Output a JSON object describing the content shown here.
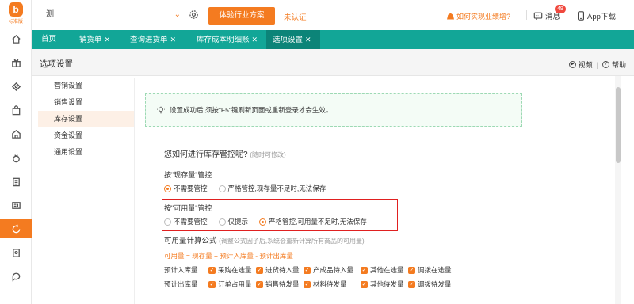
{
  "app": {
    "logo_text": "标准版",
    "logo_mark": "b"
  },
  "topbar": {
    "store_name": "测",
    "trial_button": "体验行业方案",
    "unverified": "未认证",
    "growth_link": "如何实现业绩增?",
    "messages_label": "消息",
    "messages_count": "49",
    "app_download": "App下载"
  },
  "tabs": [
    {
      "label": "首页",
      "closable": false,
      "active": false
    },
    {
      "label": "销货单",
      "closable": true,
      "active": false
    },
    {
      "label": "查询进货单",
      "closable": true,
      "active": false
    },
    {
      "label": "库存成本明细账",
      "closable": true,
      "active": false
    },
    {
      "label": "选项设置",
      "closable": true,
      "active": true
    }
  ],
  "page": {
    "title": "选项设置",
    "video": "视频",
    "help": "帮助"
  },
  "submenu": [
    {
      "label": "营销设置",
      "active": false
    },
    {
      "label": "销售设置",
      "active": false
    },
    {
      "label": "库存设置",
      "active": true
    },
    {
      "label": "资金设置",
      "active": false
    },
    {
      "label": "通用设置",
      "active": false
    }
  ],
  "notice": "设置成功后,须按\"F5\"键刷新页面或重新登录才会生效。",
  "question": {
    "text": "您如何进行库存管控呢?",
    "sub": "(随时可修改)"
  },
  "stock_control": {
    "title": "按\"现存量\"管控",
    "options": [
      {
        "label": "不需要管控",
        "checked": true
      },
      {
        "label": "严格管控,现存量不足时,无法保存",
        "checked": false
      }
    ]
  },
  "available_control": {
    "title": "按\"可用量\"管控",
    "options": [
      {
        "label": "不需要管控",
        "checked": false
      },
      {
        "label": "仅提示",
        "checked": false
      },
      {
        "label": "严格管控,可用量不足时,无法保存",
        "checked": true
      }
    ]
  },
  "formula": {
    "title": "可用量计算公式",
    "sub": "(调整公式因子后,系统会重新计算所有商品的可用量)",
    "expression": "可用量 = 现存量 + 预计入库量 - 预计出库量",
    "inbound": {
      "label": "预计入库量",
      "items": [
        "采购在途量",
        "进货待入量",
        "产成品待入量",
        "其他在途量",
        "调拨在途量"
      ]
    },
    "outbound": {
      "label": "预计出库量",
      "items": [
        "订单占用量",
        "销售待发量",
        "材料待发量",
        "其他待发量",
        "调拨待发量"
      ]
    }
  },
  "colors": {
    "brand": "#f47b20",
    "tabbar": "#12a697",
    "highlight_box": "#e02020"
  }
}
